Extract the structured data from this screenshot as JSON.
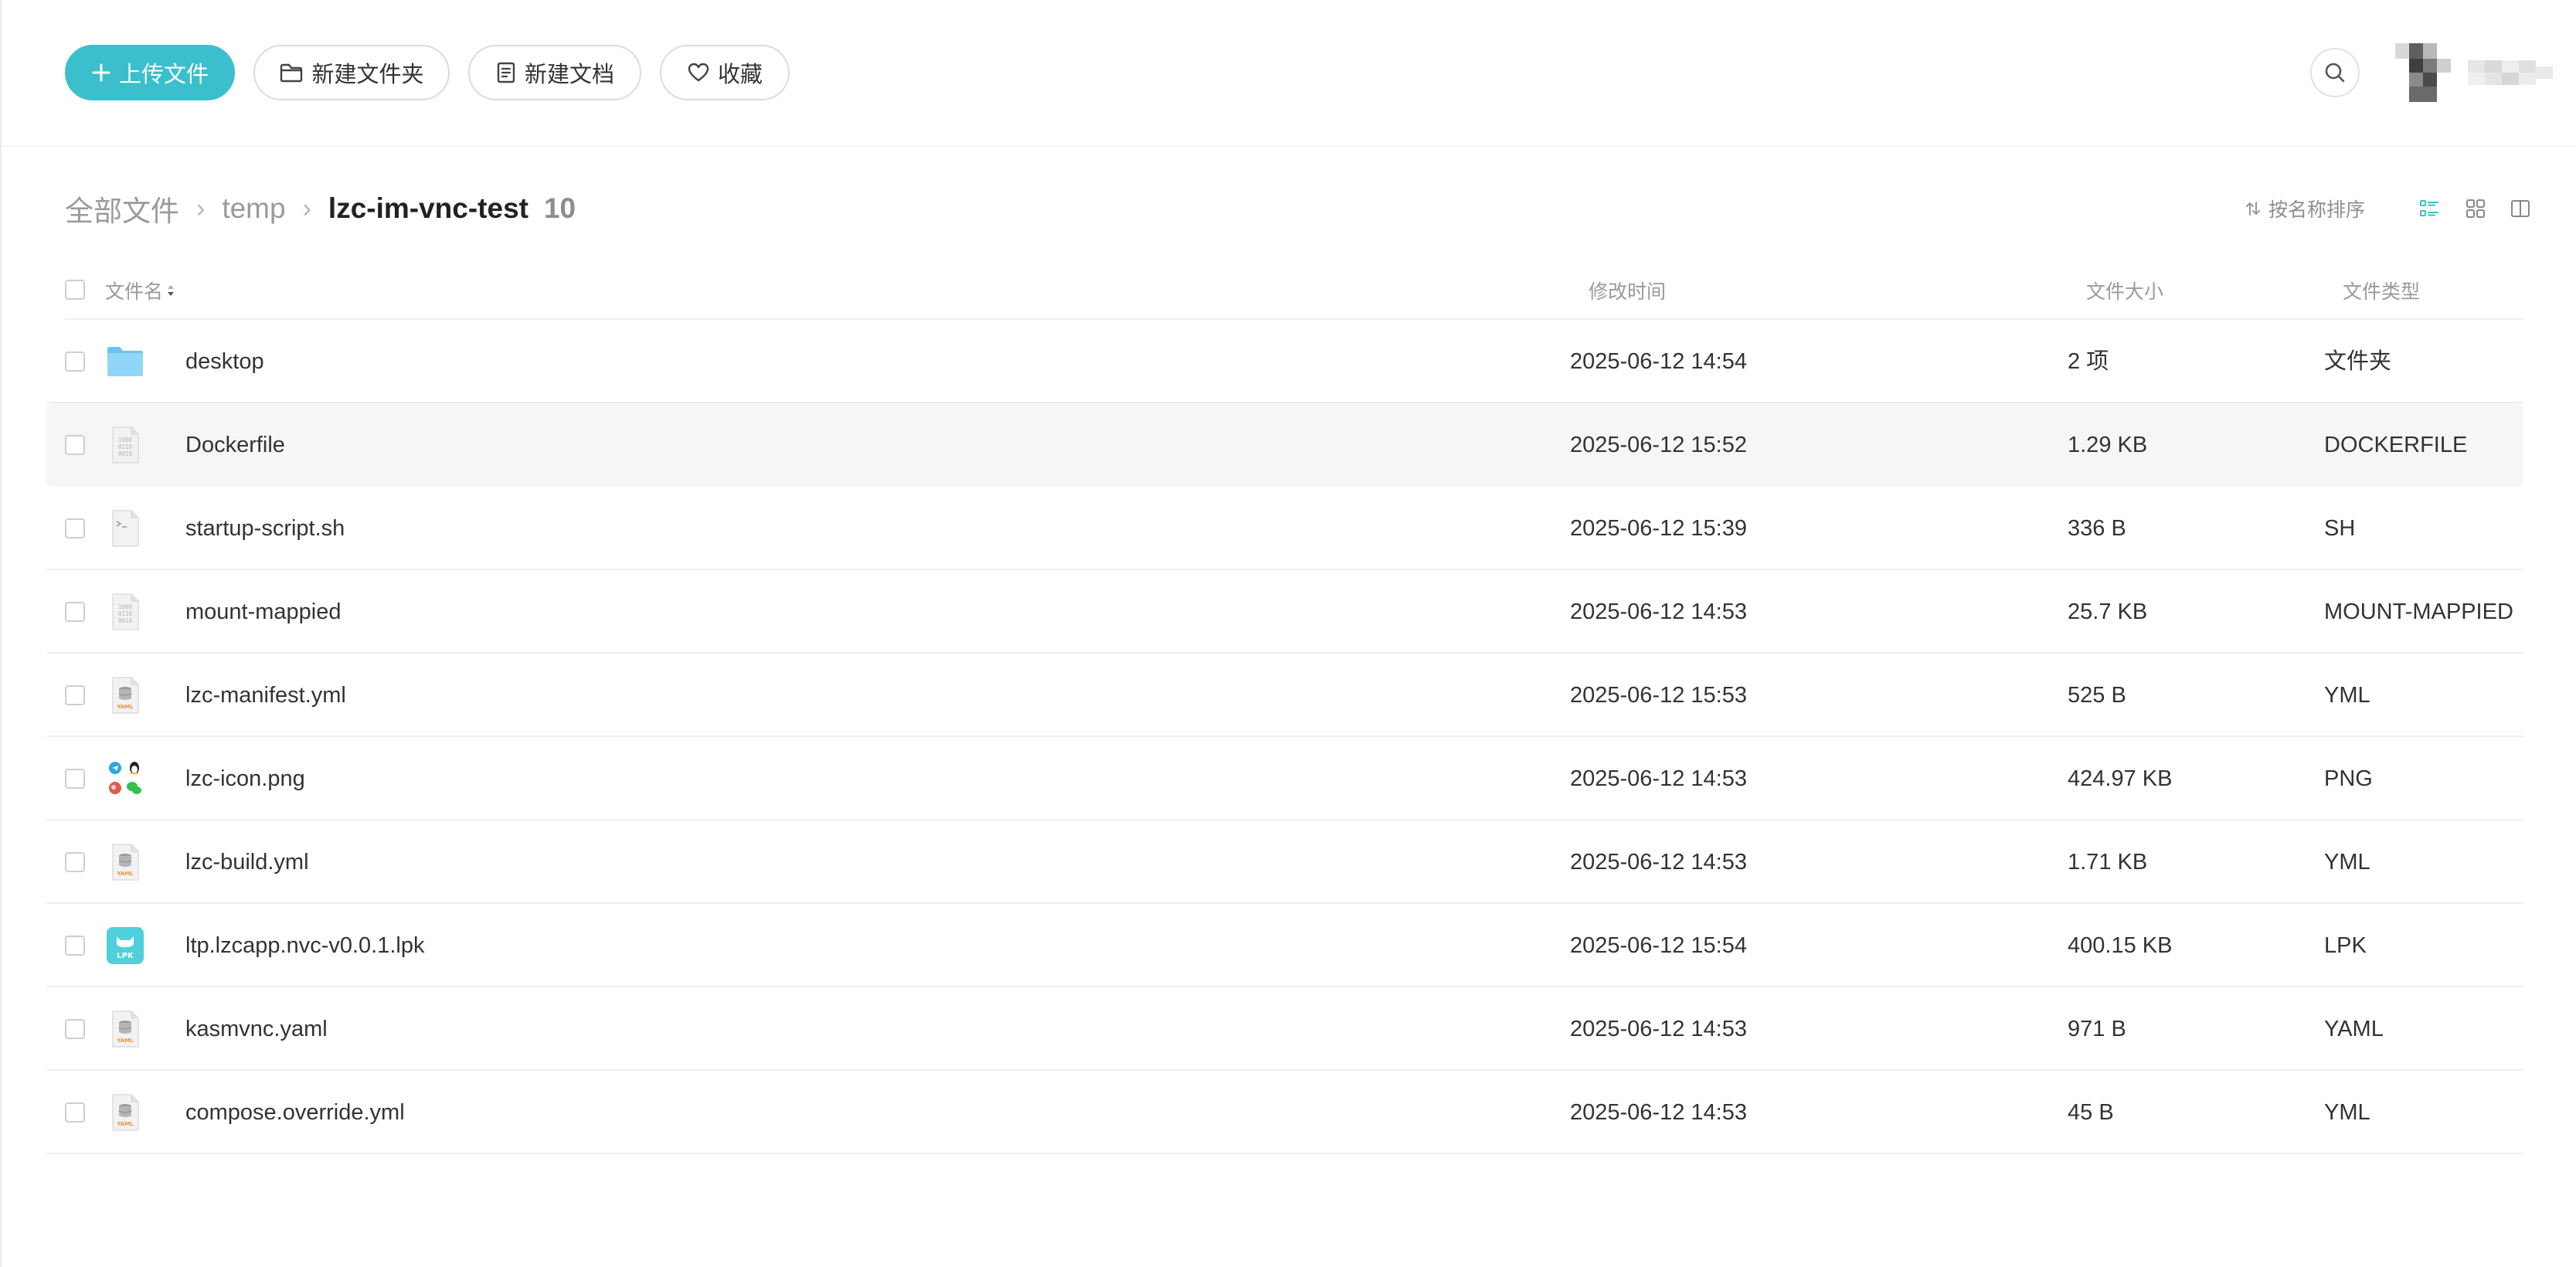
{
  "toolbar": {
    "upload_label": "上传文件",
    "new_folder_label": "新建文件夹",
    "new_doc_label": "新建文档",
    "favorites_label": "收藏"
  },
  "colors": {
    "accent": "#3bbfcc",
    "row_hover": "#f5f6f7",
    "folder": "#7ccdf5",
    "lpk": "#4fd0dc"
  },
  "breadcrumb": {
    "root": "全部文件",
    "parent": "temp",
    "current": "lzc-im-vnc-test",
    "count": "10"
  },
  "sort": {
    "label": "按名称排序"
  },
  "table": {
    "headers": {
      "name": "文件名",
      "modified": "修改时间",
      "size": "文件大小",
      "type": "文件类型"
    },
    "rows": [
      {
        "name": "desktop",
        "modified": "2025-06-12 14:54",
        "size": "2 项",
        "type": "文件夹",
        "icon": "folder-icon"
      },
      {
        "name": "Dockerfile",
        "modified": "2025-06-12 15:52",
        "size": "1.29 KB",
        "type": "DOCKERFILE",
        "icon": "binary-file-icon"
      },
      {
        "name": "startup-script.sh",
        "modified": "2025-06-12 15:39",
        "size": "336 B",
        "type": "SH",
        "icon": "script-file-icon"
      },
      {
        "name": "mount-mappied",
        "modified": "2025-06-12 14:53",
        "size": "25.7 KB",
        "type": "MOUNT-MAPPIED",
        "icon": "binary-file-icon"
      },
      {
        "name": "lzc-manifest.yml",
        "modified": "2025-06-12 15:53",
        "size": "525 B",
        "type": "YML",
        "icon": "yaml-file-icon"
      },
      {
        "name": "lzc-icon.png",
        "modified": "2025-06-12 14:53",
        "size": "424.97 KB",
        "type": "PNG",
        "icon": "image-thumbnail-icon"
      },
      {
        "name": "lzc-build.yml",
        "modified": "2025-06-12 14:53",
        "size": "1.71 KB",
        "type": "YML",
        "icon": "yaml-file-icon"
      },
      {
        "name": "ltp.lzcapp.nvc-v0.0.1.lpk",
        "modified": "2025-06-12 15:54",
        "size": "400.15 KB",
        "type": "LPK",
        "icon": "lpk-file-icon"
      },
      {
        "name": "kasmvnc.yaml",
        "modified": "2025-06-12 14:53",
        "size": "971 B",
        "type": "YAML",
        "icon": "yaml-file-icon"
      },
      {
        "name": "compose.override.yml",
        "modified": "2025-06-12 14:53",
        "size": "45 B",
        "type": "YML",
        "icon": "yaml-file-icon"
      }
    ]
  }
}
